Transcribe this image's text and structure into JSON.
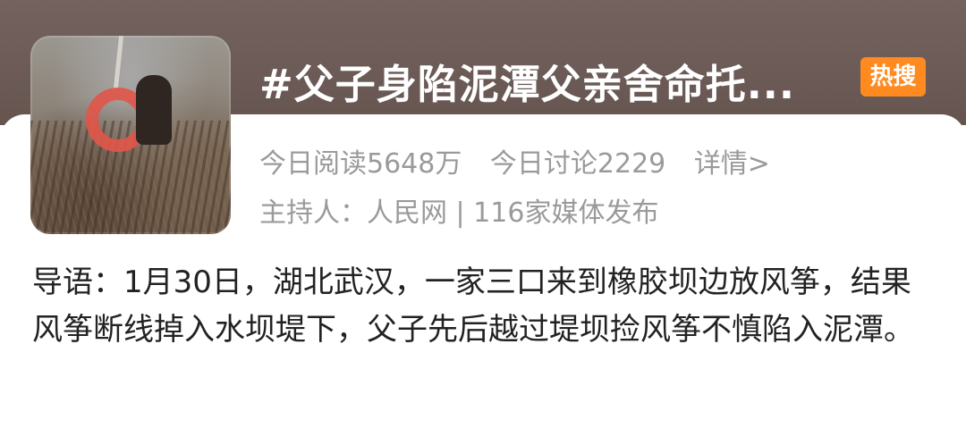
{
  "topic": {
    "title": "#父子身陷泥潭父亲舍命托...",
    "badge": "热搜",
    "read_label": "今日阅读5648万",
    "discuss_label": "今日讨论2229",
    "details_link": "详情>",
    "host_line": "主持人：人民网 | 116家媒体发布",
    "intro": "导语：1月30日，湖北武汉，一家三口来到橡胶坝边放风筝，结果风筝断线掉入水坝堤下，父子先后越过堤坝捡风筝不慎陷入泥潭。"
  },
  "colors": {
    "header_bg": "#6c5b57",
    "badge_bg": "#ff8a1f",
    "meta_text": "#9a9a9a",
    "body_text": "#222222"
  }
}
